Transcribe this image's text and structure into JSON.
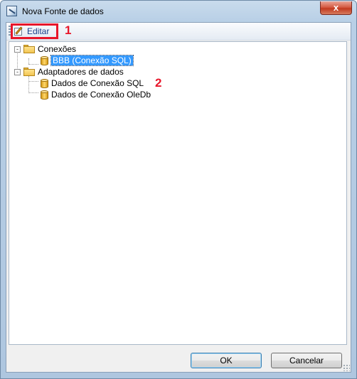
{
  "window": {
    "title": "Nova Fonte de dados",
    "close_label": "x"
  },
  "toolbar": {
    "edit_label": "Editar"
  },
  "annotations": [
    "1",
    "2"
  ],
  "tree": {
    "connections_label": "Conexões",
    "connection_item": "BBB (Conexão SQL)",
    "adapters_label": "Adaptadores de dados",
    "adapters": [
      "Dados de Conexão SQL",
      "Dados de Conexão OleDb"
    ],
    "expander_expanded": "-"
  },
  "buttons": {
    "ok_label": "OK",
    "cancel_label": "Cancelar"
  },
  "colors": {
    "annotation": "#e8162a",
    "selection": "#3399ff"
  }
}
